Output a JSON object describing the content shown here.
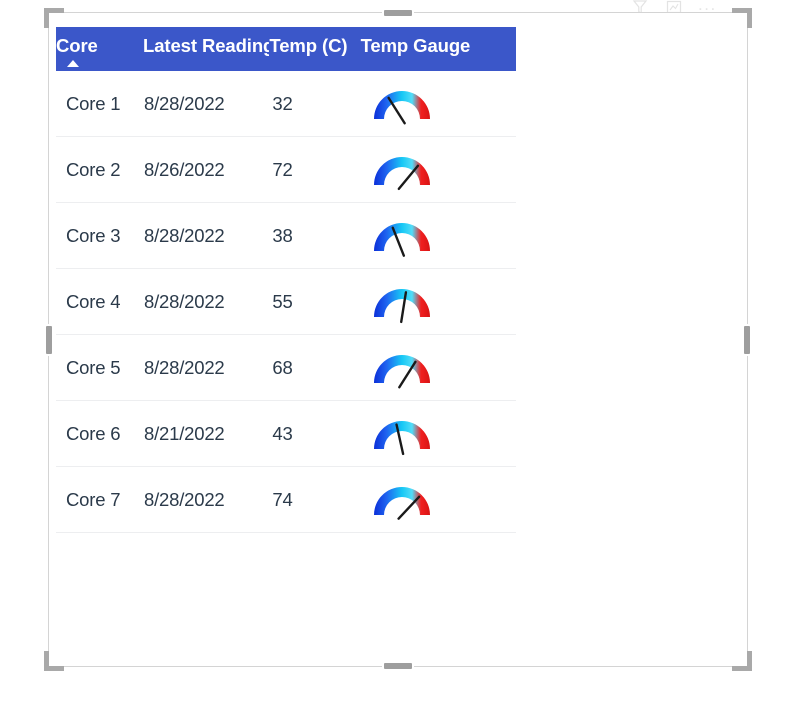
{
  "visual_header": {
    "icons": [
      {
        "name": "filter-icon",
        "glyph": "filter"
      },
      {
        "name": "focus-mode-icon",
        "glyph": "focus"
      },
      {
        "name": "more-options-icon",
        "glyph": "..."
      }
    ]
  },
  "table": {
    "columns": [
      {
        "key": "core",
        "label": "Core",
        "sorted": true,
        "sort_direction": "ascending"
      },
      {
        "key": "reading",
        "label": "Latest Reading",
        "sorted": false,
        "sort_direction": ""
      },
      {
        "key": "temp",
        "label": "Temp (C)",
        "sorted": false,
        "sort_direction": ""
      },
      {
        "key": "gauge",
        "label": "Temp Gauge",
        "sorted": false,
        "sort_direction": ""
      }
    ],
    "rows": [
      {
        "core": "Core 1",
        "reading": "8/28/2022",
        "temp": "32",
        "gauge_value": 32
      },
      {
        "core": "Core 2",
        "reading": "8/26/2022",
        "temp": "72",
        "gauge_value": 72
      },
      {
        "core": "Core 3",
        "reading": "8/28/2022",
        "temp": "38",
        "gauge_value": 38
      },
      {
        "core": "Core 4",
        "reading": "8/28/2022",
        "temp": "55",
        "gauge_value": 55
      },
      {
        "core": "Core 5",
        "reading": "8/28/2022",
        "temp": "68",
        "gauge_value": 68
      },
      {
        "core": "Core 6",
        "reading": "8/21/2022",
        "temp": "43",
        "gauge_value": 43
      },
      {
        "core": "Core 7",
        "reading": "8/28/2022",
        "temp": "74",
        "gauge_value": 74
      }
    ]
  },
  "gauge": {
    "min": 0,
    "max": 100,
    "arc_colors": [
      "#0b2fd8",
      "#1f63f0",
      "#17c8f5",
      "#51dcf8",
      "#f02020",
      "#d81414"
    ],
    "needle_color": "#1a1a1a"
  },
  "colors": {
    "header_background": "#3b57c9",
    "header_text": "#ffffff",
    "cell_text": "#2b3a4a",
    "row_divider": "#edeef0",
    "container_border": "#d4d4d4",
    "handle": "#9e9e9e",
    "page_background": "#ffffff"
  }
}
